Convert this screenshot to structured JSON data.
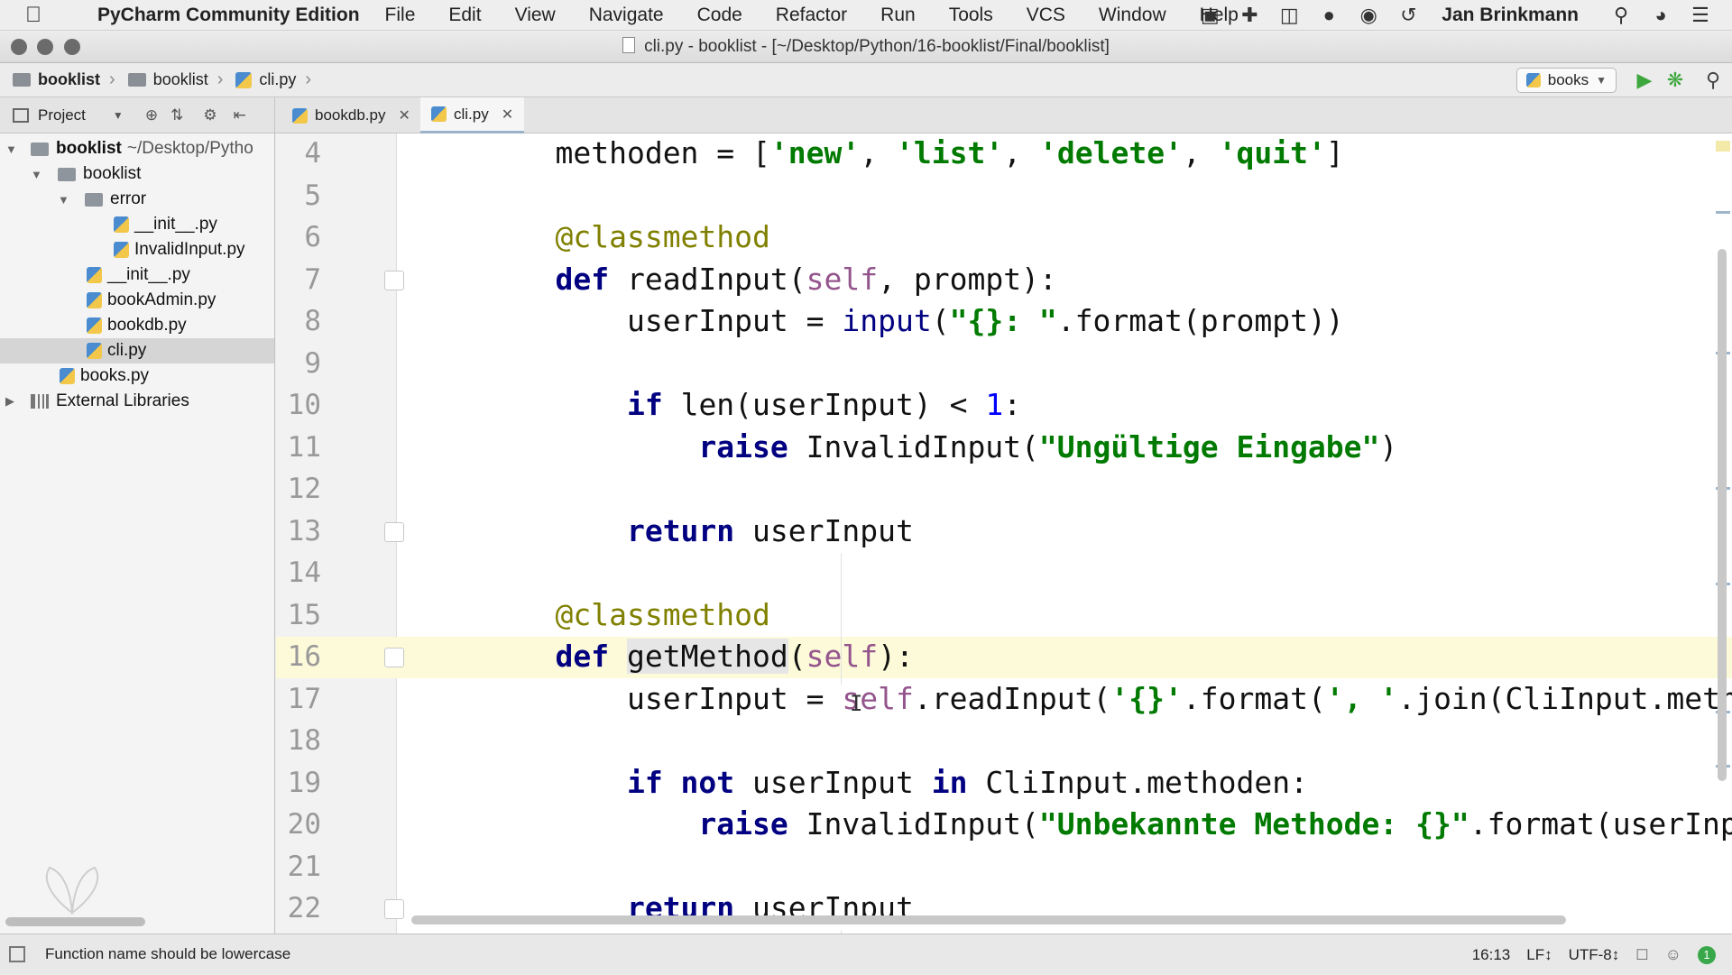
{
  "menubar": {
    "app_name": "PyCharm Community Edition",
    "items": [
      "File",
      "Edit",
      "View",
      "Navigate",
      "Code",
      "Refactor",
      "Run",
      "Tools",
      "VCS",
      "Window",
      "Help"
    ],
    "user": "Jan Brinkmann"
  },
  "window": {
    "title": "cli.py - booklist - [~/Desktop/Python/16-booklist/Final/booklist]"
  },
  "breadcrumb": {
    "items": [
      "booklist",
      "booklist",
      "cli.py"
    ]
  },
  "toolbar": {
    "run_config": "books"
  },
  "project_panel": {
    "label": "Project"
  },
  "tabs": [
    {
      "label": "bookdb.py",
      "active": false
    },
    {
      "label": "cli.py",
      "active": true
    }
  ],
  "tree": [
    {
      "label": "booklist",
      "path": "~/Desktop/Pytho",
      "depth": 0,
      "type": "folder",
      "expanded": true,
      "bold": true
    },
    {
      "label": "booklist",
      "depth": 1,
      "type": "folder",
      "expanded": true
    },
    {
      "label": "error",
      "depth": 2,
      "type": "folder",
      "expanded": true
    },
    {
      "label": "__init__.py",
      "depth": 3,
      "type": "file"
    },
    {
      "label": "InvalidInput.py",
      "depth": 3,
      "type": "file"
    },
    {
      "label": "__init__.py",
      "depth": 2,
      "type": "file"
    },
    {
      "label": "bookAdmin.py",
      "depth": 2,
      "type": "file"
    },
    {
      "label": "bookdb.py",
      "depth": 2,
      "type": "file"
    },
    {
      "label": "cli.py",
      "depth": 2,
      "type": "file",
      "selected": true
    },
    {
      "label": "books.py",
      "depth": 1,
      "type": "file"
    },
    {
      "label": "External Libraries",
      "depth": 0,
      "type": "lib",
      "expanded": false
    }
  ],
  "editor": {
    "current_line": 16,
    "lines": [
      {
        "n": "4",
        "tokens": [
          [
            "    ",
            ""
          ],
          [
            "methoden",
            ""
          ],
          [
            " = [",
            ""
          ],
          [
            "'new'",
            "str"
          ],
          [
            ", ",
            ""
          ],
          [
            "'list'",
            "str"
          ],
          [
            ", ",
            ""
          ],
          [
            "'delete'",
            "str"
          ],
          [
            ", ",
            ""
          ],
          [
            "'quit'",
            "str"
          ],
          [
            "]",
            ""
          ]
        ]
      },
      {
        "n": "5",
        "tokens": []
      },
      {
        "n": "6",
        "tokens": [
          [
            "    ",
            ""
          ],
          [
            "@classmethod",
            "deco"
          ]
        ]
      },
      {
        "n": "7",
        "fold": true,
        "tokens": [
          [
            "    ",
            ""
          ],
          [
            "def",
            "kw"
          ],
          [
            " readInput(",
            ""
          ],
          [
            "self",
            "self"
          ],
          [
            ", prompt):",
            ""
          ]
        ]
      },
      {
        "n": "8",
        "tokens": [
          [
            "        ",
            ""
          ],
          [
            "userInput = ",
            ""
          ],
          [
            "input",
            "kw2"
          ],
          [
            "(",
            ""
          ],
          [
            "\"{}: \"",
            "str"
          ],
          [
            ".format(prompt))",
            ""
          ]
        ]
      },
      {
        "n": "9",
        "tokens": []
      },
      {
        "n": "10",
        "tokens": [
          [
            "        ",
            ""
          ],
          [
            "if",
            "kw"
          ],
          [
            " len(userInput) < ",
            ""
          ],
          [
            "1",
            "num"
          ],
          [
            ":",
            ""
          ]
        ]
      },
      {
        "n": "11",
        "tokens": [
          [
            "            ",
            ""
          ],
          [
            "raise",
            "kw"
          ],
          [
            " InvalidInput(",
            ""
          ],
          [
            "\"Ungültige Eingabe\"",
            "str"
          ],
          [
            ")",
            ""
          ]
        ]
      },
      {
        "n": "12",
        "tokens": []
      },
      {
        "n": "13",
        "fold": true,
        "tokens": [
          [
            "        ",
            ""
          ],
          [
            "return",
            "kw"
          ],
          [
            " userInput",
            ""
          ]
        ]
      },
      {
        "n": "14",
        "tokens": []
      },
      {
        "n": "15",
        "tokens": [
          [
            "    ",
            ""
          ],
          [
            "@classmethod",
            "deco"
          ]
        ]
      },
      {
        "n": "16",
        "fold": true,
        "tokens": [
          [
            "    ",
            ""
          ],
          [
            "def",
            "kw"
          ],
          [
            " ",
            ""
          ],
          [
            "getMethod",
            "hl"
          ],
          [
            "(",
            ""
          ],
          [
            "self",
            "self"
          ],
          [
            "):",
            ""
          ]
        ]
      },
      {
        "n": "17",
        "tokens": [
          [
            "        ",
            ""
          ],
          [
            "userInput = ",
            ""
          ],
          [
            "self",
            "self"
          ],
          [
            ".readInput(",
            ""
          ],
          [
            "'{}'",
            "str"
          ],
          [
            ".format(",
            ""
          ],
          [
            "', '",
            "str"
          ],
          [
            ".join(CliInput.meth",
            ""
          ]
        ]
      },
      {
        "n": "18",
        "tokens": []
      },
      {
        "n": "19",
        "tokens": [
          [
            "        ",
            ""
          ],
          [
            "if not",
            "kw"
          ],
          [
            " userInput ",
            ""
          ],
          [
            "in",
            "kw"
          ],
          [
            " CliInput.methoden:",
            ""
          ]
        ]
      },
      {
        "n": "20",
        "tokens": [
          [
            "            ",
            ""
          ],
          [
            "raise",
            "kw"
          ],
          [
            " InvalidInput(",
            ""
          ],
          [
            "\"Unbekannte Methode: {}\"",
            "str"
          ],
          [
            ".format(userInp",
            ""
          ]
        ]
      },
      {
        "n": "21",
        "tokens": []
      },
      {
        "n": "22",
        "fold": true,
        "tokens": [
          [
            "        ",
            ""
          ],
          [
            "return",
            "kw"
          ],
          [
            " userInput",
            ""
          ]
        ]
      }
    ]
  },
  "statusbar": {
    "message": "Function name should be lowercase",
    "position": "16:13",
    "line_sep": "LF↕",
    "encoding": "UTF-8↕",
    "notifications": "1"
  },
  "colors": {
    "keyword": "#000080",
    "string": "#007a00",
    "self": "#94558d",
    "decorator": "#808000",
    "current_line": "#fcfad9"
  }
}
